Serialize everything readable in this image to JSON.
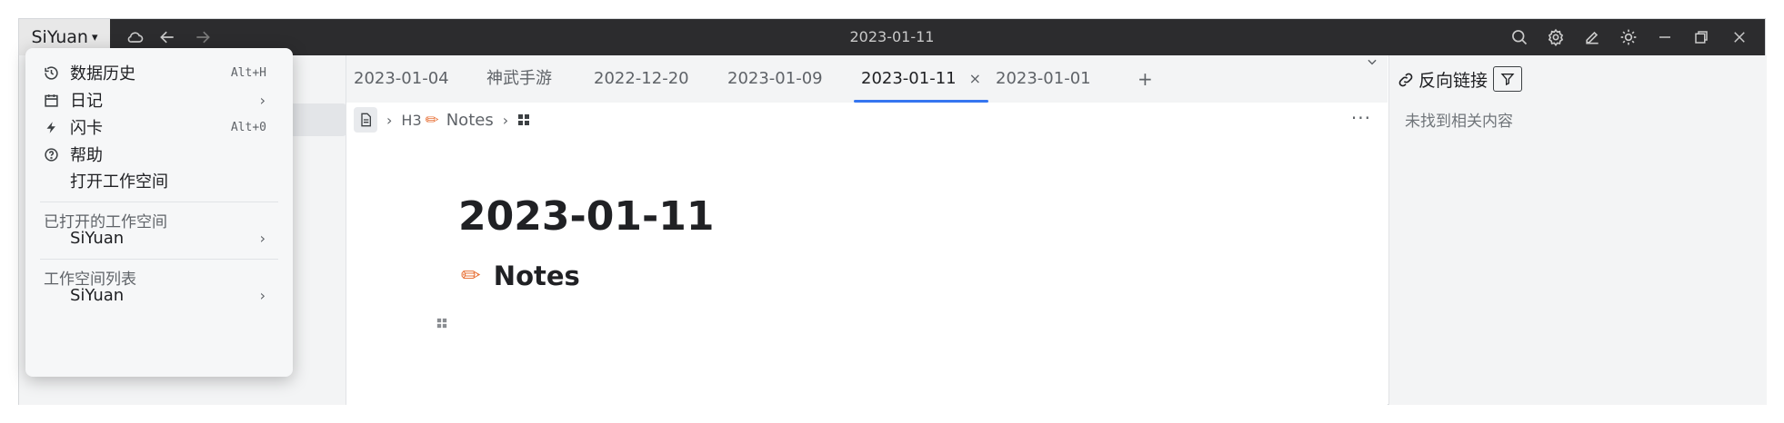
{
  "toolbar": {
    "app_name": "SiYuan",
    "title": "2023-01-11",
    "icons": [
      "cloud-sync-icon",
      "back-icon",
      "forward-icon",
      "search-icon",
      "settings-icon",
      "edit-icon",
      "theme-icon",
      "minimize-icon",
      "restore-icon",
      "close-icon"
    ]
  },
  "tabs": [
    {
      "label": "2023-01-04",
      "active": false
    },
    {
      "label": "神武手游",
      "active": false
    },
    {
      "label": "2022-12-20",
      "active": false
    },
    {
      "label": "2023-01-09",
      "active": false
    },
    {
      "label": "2023-01-11",
      "active": true,
      "close": "×"
    },
    {
      "label": "2023-01-01",
      "active": false
    }
  ],
  "tab_add": "+",
  "breadcrumb": {
    "h3": "H3",
    "item": "Notes"
  },
  "editor": {
    "doc_title": "2023-01-11",
    "heading": "Notes",
    "more": "···"
  },
  "backlinks": {
    "title": "反向链接",
    "empty": "未找到相关内容"
  },
  "menu": {
    "items": [
      {
        "label": "数据历史",
        "shortcut": "Alt+H",
        "icon": "history-icon"
      },
      {
        "label": "日记",
        "submenu": true,
        "icon": "calendar-icon"
      },
      {
        "label": "闪卡",
        "shortcut": "Alt+0",
        "icon": "flash-icon"
      },
      {
        "label": "帮助",
        "icon": "help-icon"
      },
      {
        "label": "打开工作空间"
      }
    ],
    "opened_section": "已打开的工作空间",
    "opened_workspace": "SiYuan",
    "list_section": "工作空间列表",
    "list_workspace": "SiYuan"
  },
  "colors": {
    "accent": "#3575f0",
    "toolbar_bg": "#2c2c2e"
  }
}
